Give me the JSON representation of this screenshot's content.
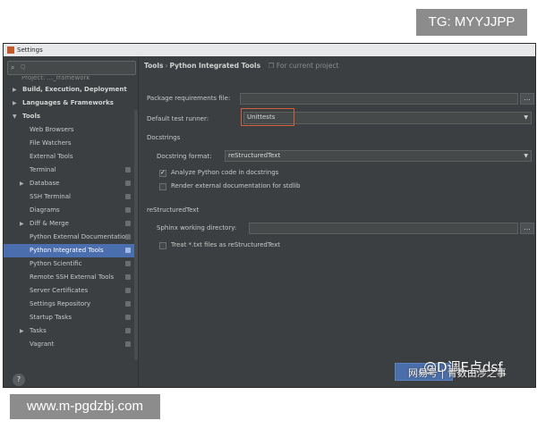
{
  "watermarks": {
    "top": "TG: MYYJJPP",
    "bottom": "www.m-pgdzbj.com",
    "logo_line1": "@D调E点dsf",
    "logo_line2": "网易号 | 青数由涉之事"
  },
  "window": {
    "title": "Settings"
  },
  "sidebar": {
    "search_placeholder": "Q",
    "cut_item": "Project: ..._framework",
    "items": [
      {
        "label": "Build, Execution, Deployment",
        "level": 0,
        "arrow": "▶"
      },
      {
        "label": "Languages & Frameworks",
        "level": 0,
        "arrow": "▶"
      },
      {
        "label": "Tools",
        "level": 0,
        "arrow": "▼"
      },
      {
        "label": "Web Browsers",
        "level": 1
      },
      {
        "label": "File Watchers",
        "level": 1
      },
      {
        "label": "External Tools",
        "level": 1
      },
      {
        "label": "Terminal",
        "level": 1
      },
      {
        "label": "Database",
        "level": 1,
        "arrow": "▶"
      },
      {
        "label": "SSH Terminal",
        "level": 1
      },
      {
        "label": "Diagrams",
        "level": 1
      },
      {
        "label": "Diff & Merge",
        "level": 1,
        "arrow": "▶"
      },
      {
        "label": "Python External Documentation",
        "level": 1
      },
      {
        "label": "Python Integrated Tools",
        "level": 1,
        "selected": true
      },
      {
        "label": "Python Scientific",
        "level": 1
      },
      {
        "label": "Remote SSH External Tools",
        "level": 1
      },
      {
        "label": "Server Certificates",
        "level": 1
      },
      {
        "label": "Settings Repository",
        "level": 1
      },
      {
        "label": "Startup Tasks",
        "level": 1
      },
      {
        "label": "Tasks",
        "level": 1,
        "arrow": "▶"
      },
      {
        "label": "Vagrant",
        "level": 1
      }
    ],
    "help": "?"
  },
  "content": {
    "breadcrumb_root": "Tools",
    "breadcrumb_sep": "›",
    "breadcrumb_page": "Python Integrated Tools",
    "breadcrumb_scope": "For current project",
    "package_label": "Package requirements file:",
    "package_value": "",
    "dots": "...",
    "test_runner_label": "Default test runner:",
    "test_runner_value": "Unittests",
    "docstrings_title": "Docstrings",
    "docstring_format_label": "Docstring format:",
    "docstring_format_value": "reStructuredText",
    "analyze_label": "Analyze Python code in docstrings",
    "render_label": "Render external documentation for stdlib",
    "rst_title": "reStructuredText",
    "sphinx_label": "Sphinx working directory:",
    "sphinx_value": "",
    "treat_label": "Treat *.txt files as reStructuredText",
    "checkmark": "✓",
    "chevron": "▼"
  },
  "buttons": {
    "ok": "OK"
  }
}
